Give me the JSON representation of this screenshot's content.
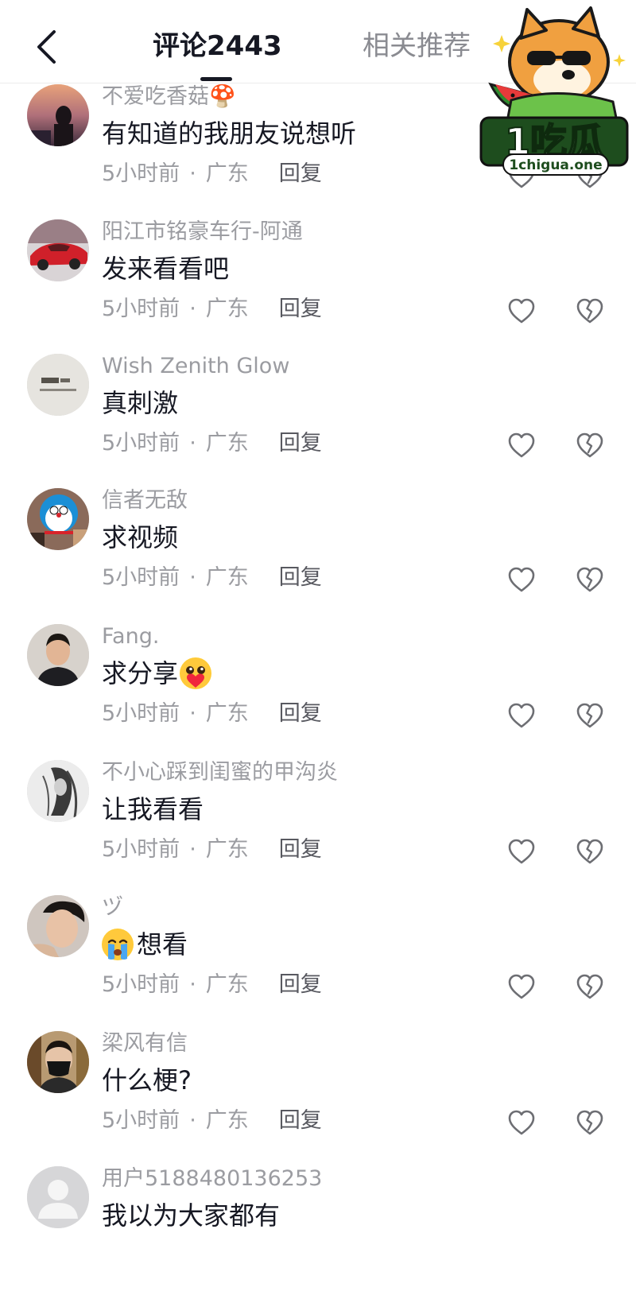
{
  "header": {
    "back_icon": "chevron-left-icon",
    "tab_comments": "评论2443",
    "tab_related": "相关推荐"
  },
  "watermark": {
    "logo_text": "1吃瓜",
    "logo_url": "1chigua.one"
  },
  "comments": [
    {
      "username": "不爱吃香菇🍄",
      "text": "有知道的我朋友说想听",
      "time": "5小时前",
      "sep": "·",
      "location": "广东",
      "reply": "回复",
      "avatar": "dusk-portrait"
    },
    {
      "username": "阳江市铭豪车行-阿通",
      "text": "发来看看吧",
      "time": "5小时前",
      "sep": "·",
      "location": "广东",
      "reply": "回复",
      "avatar": "red-sports-car"
    },
    {
      "username": "Wish Zenith Glow",
      "text": "真刺激",
      "time": "5小时前",
      "sep": "·",
      "location": "广东",
      "reply": "回复",
      "avatar": "book-cover"
    },
    {
      "username": "信者无敌",
      "text": "求视频",
      "time": "5小时前",
      "sep": "·",
      "location": "广东",
      "reply": "回复",
      "avatar": "doraemon"
    },
    {
      "username": "Fang.",
      "text": "求分享",
      "emoji_after": "pleading-heart",
      "time": "5小时前",
      "sep": "·",
      "location": "广东",
      "reply": "回复",
      "avatar": "man-portrait"
    },
    {
      "username": "不小心踩到闺蜜的甲沟炎",
      "text": "让我看看",
      "time": "5小时前",
      "sep": "·",
      "location": "广东",
      "reply": "回复",
      "avatar": "sketch-portrait"
    },
    {
      "username": "ヅ",
      "text": "想看",
      "emoji_before": "crying-face",
      "time": "5小时前",
      "sep": "·",
      "location": "广东",
      "reply": "回复",
      "avatar": "selfie-portrait"
    },
    {
      "username": "梁风有信",
      "text": "什么梗?",
      "time": "5小时前",
      "sep": "·",
      "location": "广东",
      "reply": "回复",
      "avatar": "masked-man"
    },
    {
      "username": "用户5188480136253",
      "text": "我以为大家都有",
      "time": "",
      "sep": "",
      "location": "",
      "reply": "",
      "avatar": "default-user"
    }
  ],
  "icons": {
    "like": "heart-outline-icon",
    "dislike": "broken-heart-icon"
  }
}
